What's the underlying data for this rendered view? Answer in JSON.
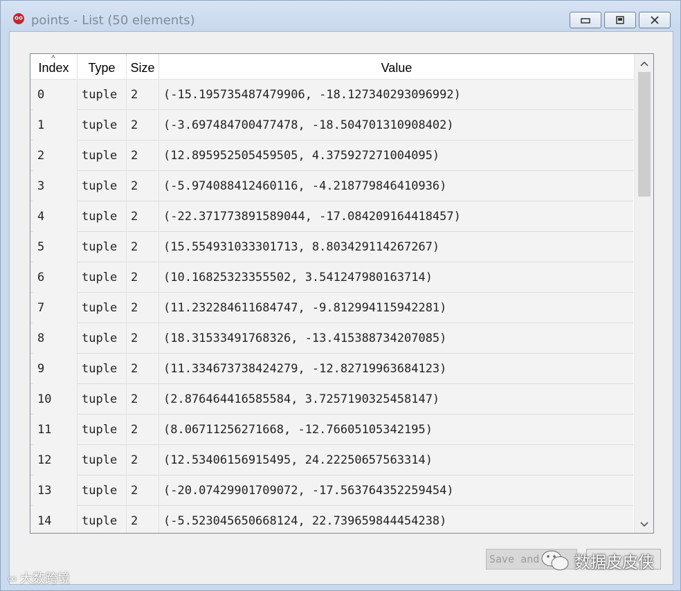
{
  "window": {
    "title": "points - List (50 elements)",
    "min_symbol": "▭",
    "max_symbol": "▣",
    "close_symbol": "✕"
  },
  "table": {
    "columns": [
      "Index",
      "Type",
      "Size",
      "Value"
    ],
    "sort_indicator": "^",
    "rows": [
      {
        "index": "0",
        "type": "tuple",
        "size": "2",
        "value": "(-15.195735487479906, -18.127340293096992)"
      },
      {
        "index": "1",
        "type": "tuple",
        "size": "2",
        "value": "(-3.697484700477478, -18.504701310908402)"
      },
      {
        "index": "2",
        "type": "tuple",
        "size": "2",
        "value": "(12.895952505459505, 4.375927271004095)"
      },
      {
        "index": "3",
        "type": "tuple",
        "size": "2",
        "value": "(-5.974088412460116, -4.218779846410936)"
      },
      {
        "index": "4",
        "type": "tuple",
        "size": "2",
        "value": "(-22.371773891589044, -17.084209164418457)"
      },
      {
        "index": "5",
        "type": "tuple",
        "size": "2",
        "value": "(15.554931033301713, 8.803429114267267)"
      },
      {
        "index": "6",
        "type": "tuple",
        "size": "2",
        "value": "(10.16825323355502, 3.541247980163714)"
      },
      {
        "index": "7",
        "type": "tuple",
        "size": "2",
        "value": "(11.232284611684747, -9.812994115942281)"
      },
      {
        "index": "8",
        "type": "tuple",
        "size": "2",
        "value": "(18.31533491768326, -13.415388734207085)"
      },
      {
        "index": "9",
        "type": "tuple",
        "size": "2",
        "value": "(11.334673738424279, -12.82719963684123)"
      },
      {
        "index": "10",
        "type": "tuple",
        "size": "2",
        "value": "(2.876464416585584, 3.7257190325458147)"
      },
      {
        "index": "11",
        "type": "tuple",
        "size": "2",
        "value": "(8.06711256271668, -12.76605105342195)"
      },
      {
        "index": "12",
        "type": "tuple",
        "size": "2",
        "value": "(12.53406156915495, 24.22250657563314)"
      },
      {
        "index": "13",
        "type": "tuple",
        "size": "2",
        "value": "(-20.07429901709072, -17.563764352259454)"
      },
      {
        "index": "14",
        "type": "tuple",
        "size": "2",
        "value": "(-5.523045650668124, 22.739659844454238)"
      }
    ]
  },
  "scrollbar": {
    "up_symbol": "▲",
    "down_symbol": "▼"
  },
  "buttons": {
    "save_label": "Save and "
  },
  "watermark": {
    "right_text": "数据皮皮侠",
    "left_text": "大数跨境"
  }
}
